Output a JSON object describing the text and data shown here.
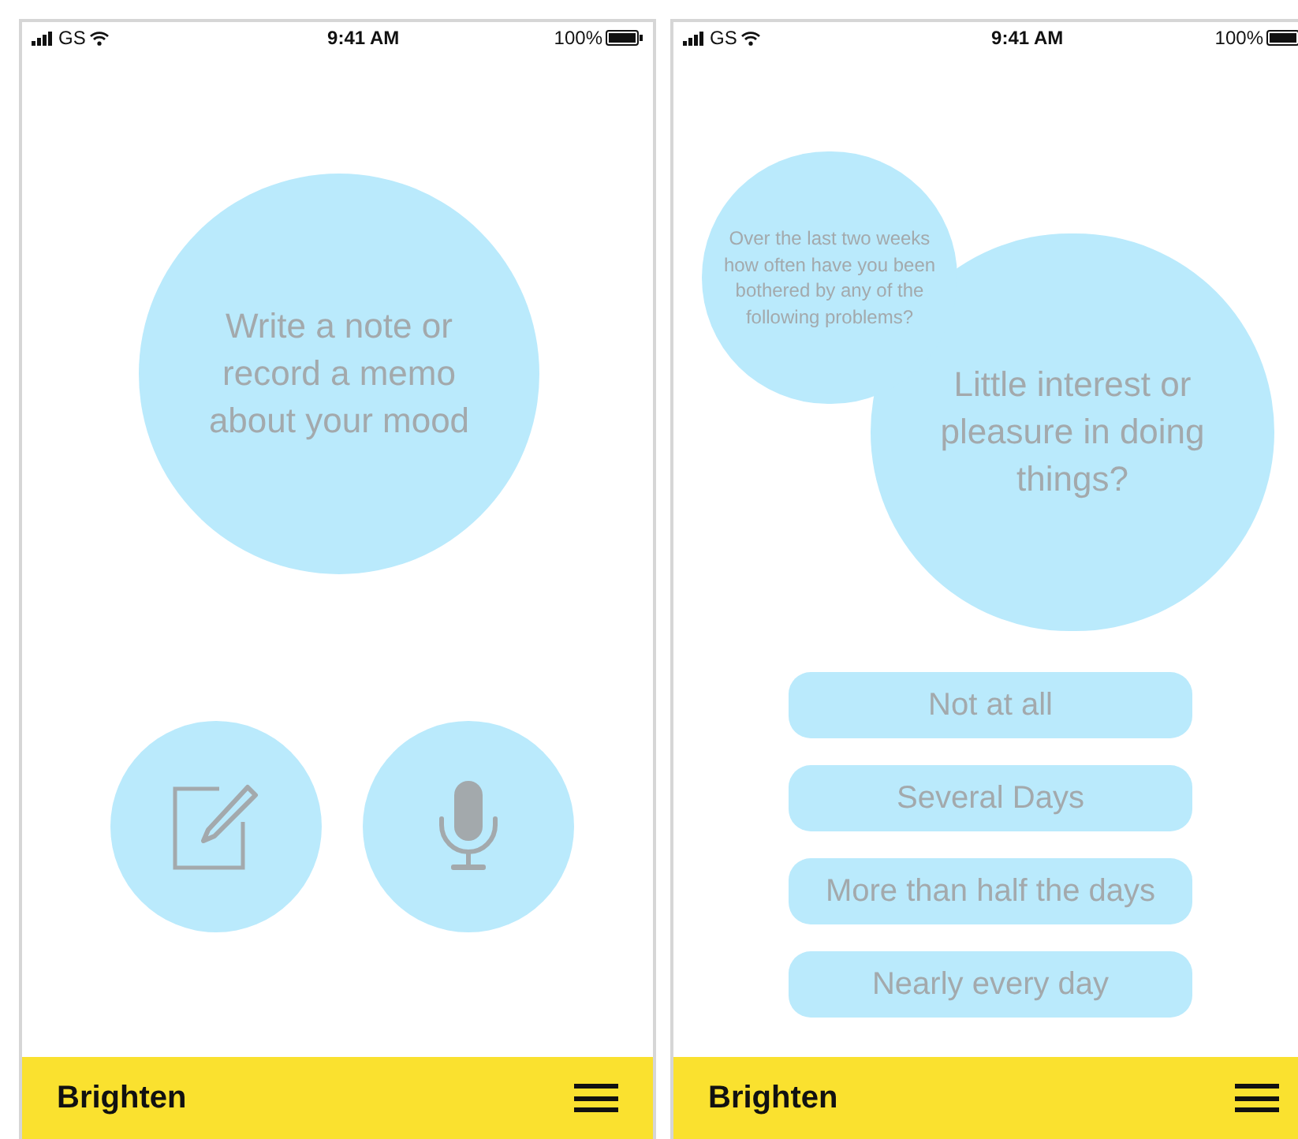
{
  "screens": [
    {
      "status_bar": {
        "carrier": "GS",
        "time": "9:41 AM",
        "battery": "100%"
      },
      "prompt": "Write a note or record a memo about your mood",
      "actions": [
        {
          "kind": "write"
        },
        {
          "kind": "record"
        }
      ],
      "footer": {
        "app_name": "Brighten"
      }
    },
    {
      "status_bar": {
        "carrier": "GS",
        "time": "9:41 AM",
        "battery": "100%"
      },
      "intro": "Over the last two weeks how often have you been bothered by any of the following problems?",
      "question": "Little interest or pleasure in doing things?",
      "options": [
        "Not at all",
        "Several Days",
        "More than half the days",
        "Nearly every day"
      ],
      "footer": {
        "app_name": "Brighten"
      }
    }
  ]
}
